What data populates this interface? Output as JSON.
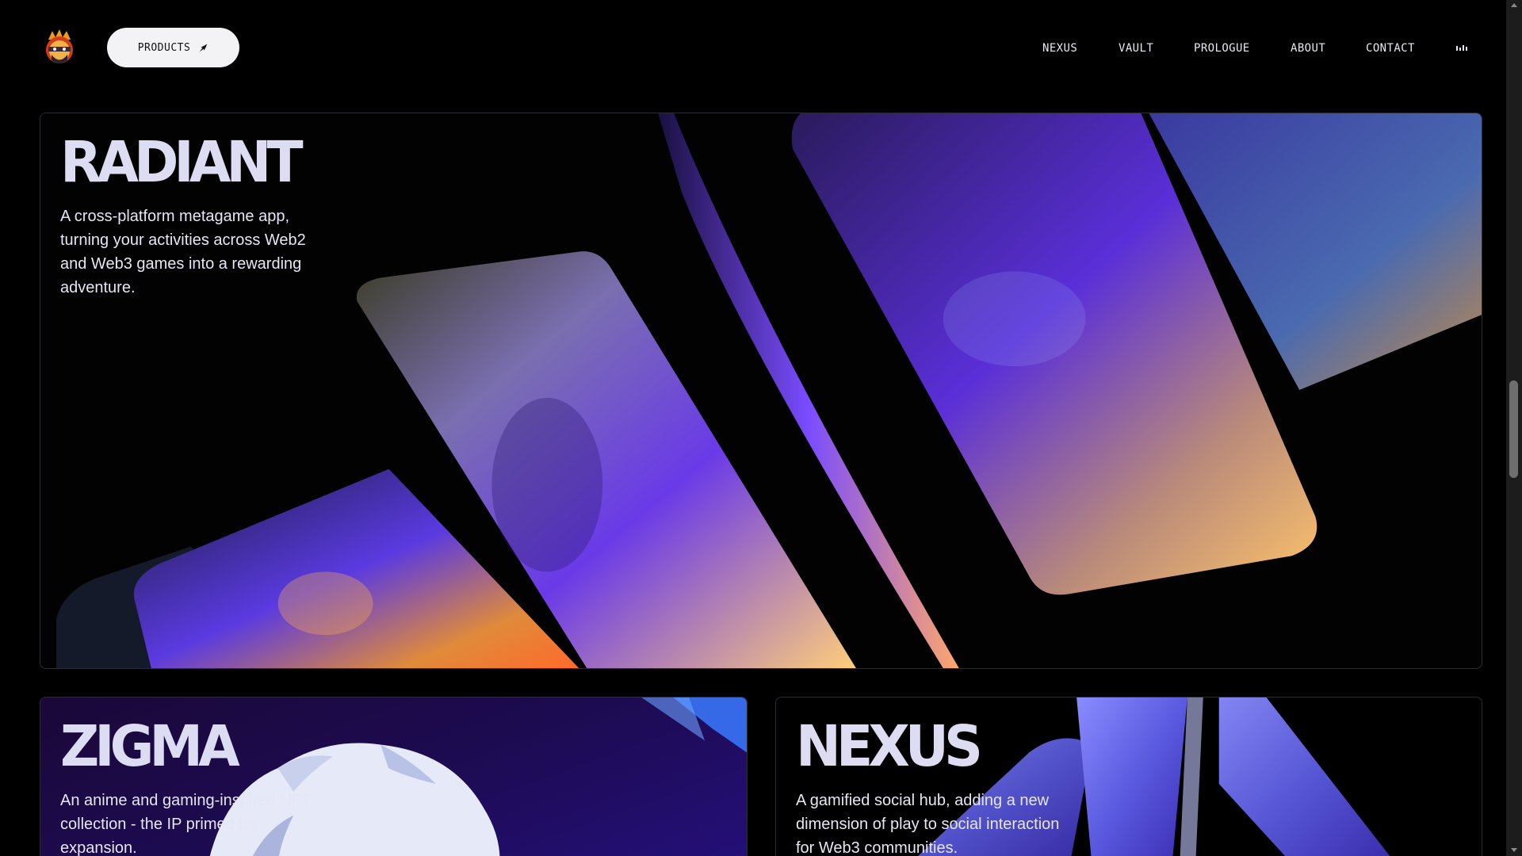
{
  "nav": {
    "logo_icon": "ninja-mascot-icon",
    "products_label": "PRODUCTS",
    "products_icon": "arrow-up-right-icon",
    "links": [
      {
        "label": "NEXUS"
      },
      {
        "label": "VAULT"
      },
      {
        "label": "PROLOGUE"
      },
      {
        "label": "ABOUT"
      },
      {
        "label": "CONTACT"
      }
    ],
    "audio_icon": "audio-bars-icon"
  },
  "cards": {
    "radiant": {
      "title": "RADIANT",
      "description": "A cross-platform metagame app, turning your activities across Web2 and Web3 games into a rewarding adventure."
    },
    "zigma": {
      "title": "ZIGMA",
      "description": "An anime and gaming-inspired NFT collection - the IP primed for expansion."
    },
    "nexus": {
      "title": "NEXUS",
      "description": "A gamified social hub, adding a new dimension of play to social interaction for Web3 communities."
    }
  },
  "colors": {
    "background": "#000000",
    "accent_purple": "#6a35ff",
    "accent_orange": "#ffb14a",
    "text_light": "#dcdcf2",
    "button_bg": "#f3f3f6"
  }
}
